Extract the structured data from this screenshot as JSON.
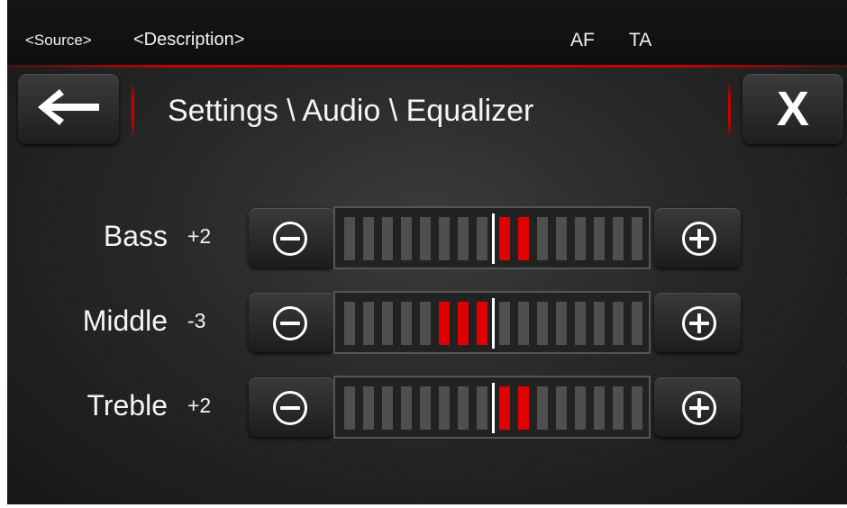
{
  "status_bar": {
    "source": "<Source>",
    "description": "<Description>",
    "af": "AF",
    "ta": "TA"
  },
  "header": {
    "back_icon": "arrow-left-icon",
    "title": "Settings \\ Audio \\ Equalizer",
    "close_label": "X"
  },
  "equalizer": {
    "segments_total": 16,
    "bands": [
      {
        "label": "Bass",
        "value_text": "+2",
        "value": 2
      },
      {
        "label": "Middle",
        "value_text": "-3",
        "value": -3
      },
      {
        "label": "Treble",
        "value_text": "+2",
        "value": 2
      }
    ]
  },
  "colors": {
    "accent_red": "#e10000",
    "segment_off": "#4f4f4f",
    "background": "#262626"
  }
}
